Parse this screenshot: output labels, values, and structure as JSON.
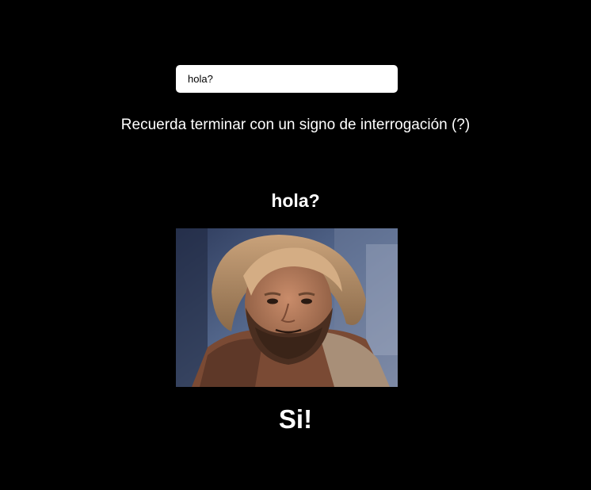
{
  "question_input": {
    "value": "hola?"
  },
  "hint": {
    "text": "Recuerda terminar con un signo de interrogación (?)"
  },
  "asked_question": {
    "text": "hola?"
  },
  "answer": {
    "text": "Si!"
  },
  "colors": {
    "background": "#000000",
    "text": "#ffffff",
    "input_background": "#ffffff"
  }
}
